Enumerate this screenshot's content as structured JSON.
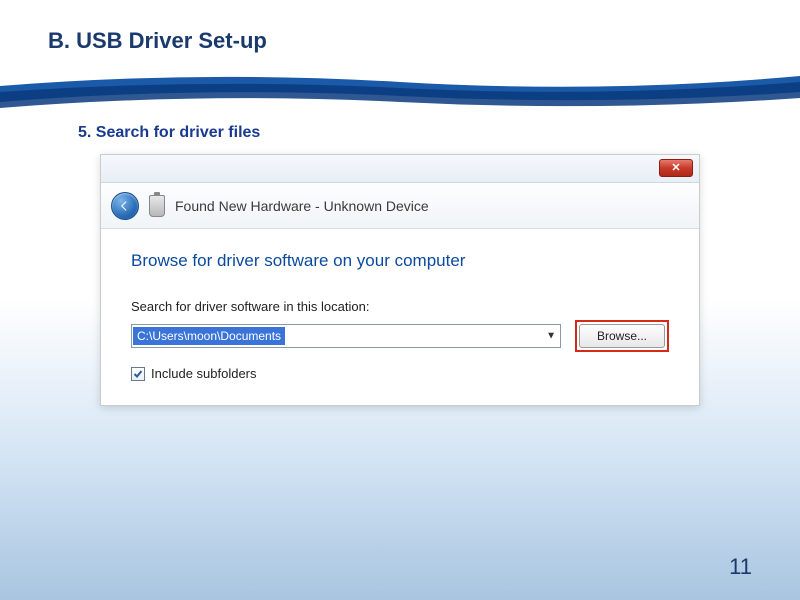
{
  "slide": {
    "title": "B. USB Driver Set-up",
    "step_title": "5. Search for driver files",
    "page_number": "11"
  },
  "window": {
    "header_text": "Found New Hardware - Unknown Device",
    "browse_heading": "Browse for driver software on your computer",
    "search_label": "Search for driver software in this location:",
    "path_value": "C:\\Users\\moon\\Documents",
    "browse_button": "Browse...",
    "include_subfolders": "Include subfolders",
    "close_label": "✕"
  }
}
